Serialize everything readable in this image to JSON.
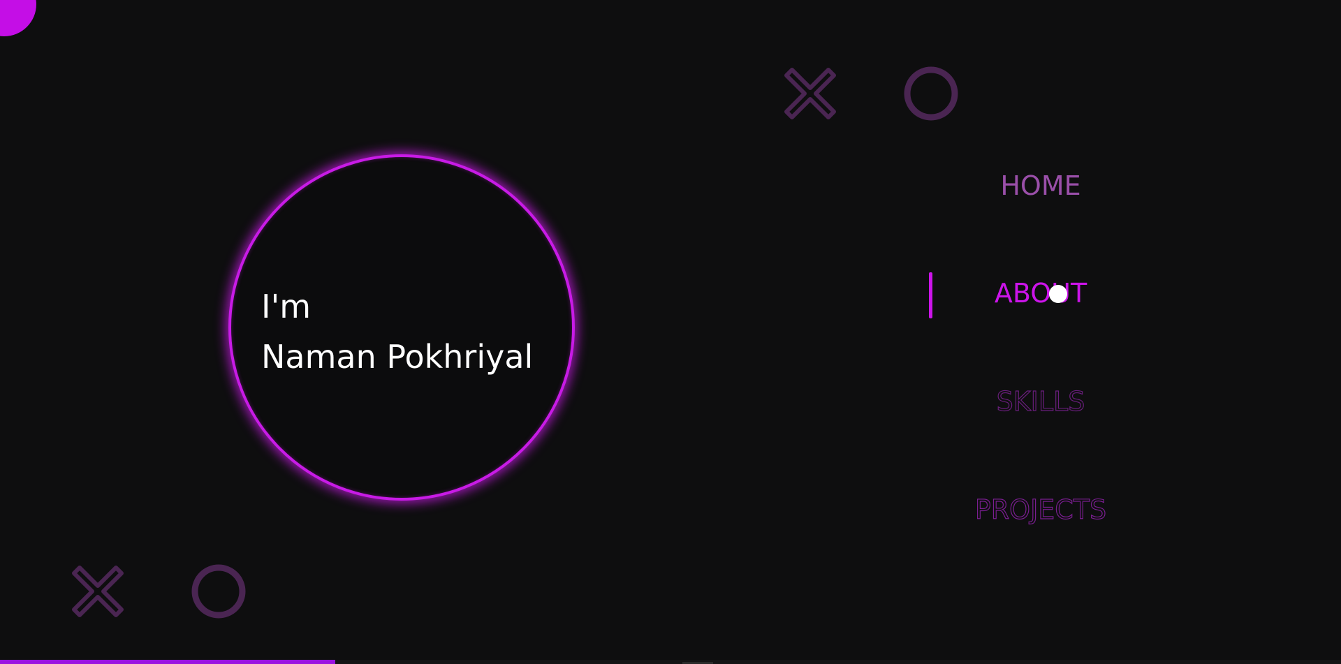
{
  "hero": {
    "line1": "I'm",
    "line2": "Naman Pokhriyal"
  },
  "nav": {
    "items": [
      {
        "label": "HOME",
        "state": "inactive"
      },
      {
        "label": "ABOUT",
        "state": "active"
      },
      {
        "label": "SKILLS",
        "state": "outline"
      },
      {
        "label": "PROJECTS",
        "state": "outline"
      }
    ]
  },
  "decorations": {
    "top": [
      "x-icon",
      "circle-icon"
    ],
    "bottom": [
      "x-icon",
      "circle-icon"
    ]
  },
  "scroll_progress": 0.25,
  "colors": {
    "background": "#0e0e0f",
    "accent": "#cc14ea",
    "decor": "#4a2552",
    "progress": "#9b12e0"
  }
}
